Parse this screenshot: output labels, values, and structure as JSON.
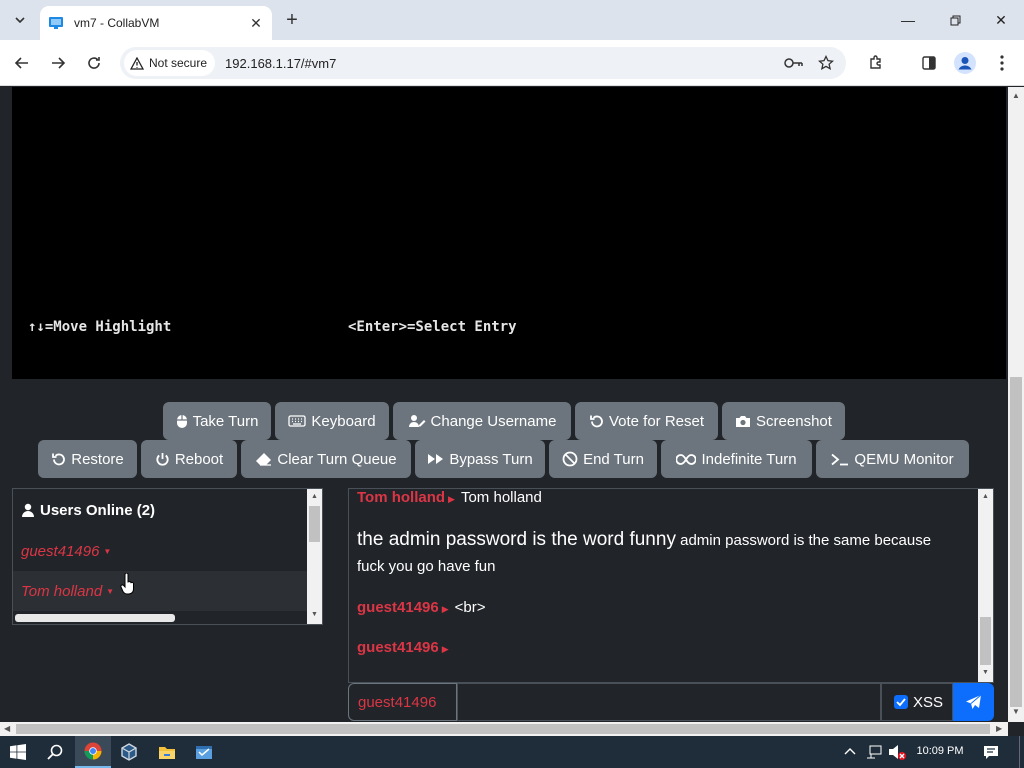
{
  "browser": {
    "tab_title": "vm7 - CollabVM",
    "security_label": "Not secure",
    "url": "192.168.1.17/#vm7"
  },
  "vm": {
    "status_left": "↑↓=Move Highlight",
    "status_right": "<Enter>=Select Entry"
  },
  "toolbar_row1": [
    {
      "label": "Take Turn",
      "icon": "mouse-icon"
    },
    {
      "label": "Keyboard",
      "icon": "keyboard-icon"
    },
    {
      "label": "Change Username",
      "icon": "user-edit-icon"
    },
    {
      "label": "Vote for Reset",
      "icon": "undo-icon"
    },
    {
      "label": "Screenshot",
      "icon": "camera-icon"
    }
  ],
  "toolbar_row2": [
    {
      "label": "Restore",
      "icon": "restore-icon"
    },
    {
      "label": "Reboot",
      "icon": "power-icon"
    },
    {
      "label": "Clear Turn Queue",
      "icon": "eraser-icon"
    },
    {
      "label": "Bypass Turn",
      "icon": "fast-forward-icon"
    },
    {
      "label": "End Turn",
      "icon": "ban-icon"
    },
    {
      "label": "Indefinite Turn",
      "icon": "infinity-icon"
    },
    {
      "label": "QEMU Monitor",
      "icon": "terminal-icon"
    }
  ],
  "users": {
    "header": "Users Online (2)",
    "list": [
      "guest41496",
      "Tom holland"
    ]
  },
  "chat": {
    "messages": [
      {
        "user": "Tom holland",
        "text": "Tom holland"
      },
      {
        "user": "",
        "big_text": "the admin password is the word funny",
        "text": " admin password is the same because fuck you go have fun"
      },
      {
        "user": "guest41496",
        "text": "<br>"
      },
      {
        "user": "guest41496",
        "text": ""
      }
    ]
  },
  "chat_input": {
    "username": "guest41496",
    "value": "",
    "xss_label": "XSS",
    "xss_checked": true
  },
  "taskbar": {
    "time": "10:09 PM"
  }
}
